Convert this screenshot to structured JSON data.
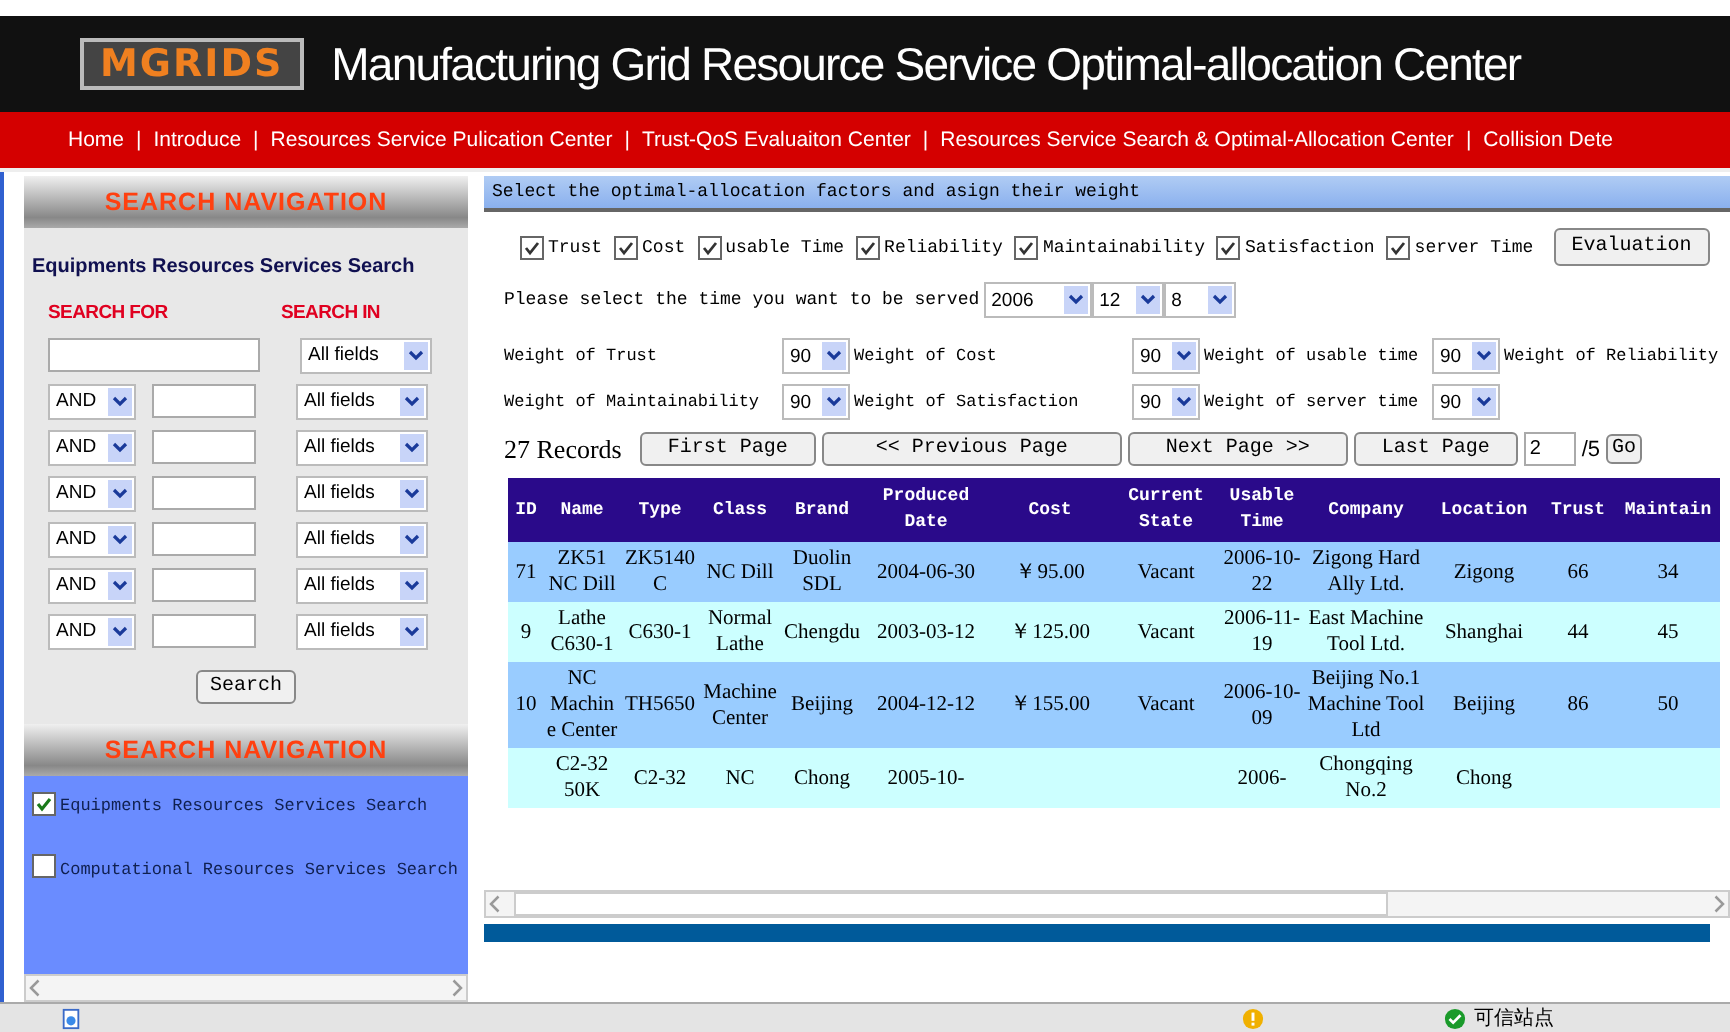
{
  "header": {
    "logo": "MGRIDS",
    "title": "Manufacturing  Grid Resource Service Optimal-allocation Center"
  },
  "nav": [
    {
      "label": "Home"
    },
    {
      "separator": "|",
      "label": "Introduce"
    },
    {
      "separator": "|",
      "label": "Resources Service Pulication Center"
    },
    {
      "separator": "|",
      "label": "Trust-QoS Evaluaiton Center"
    },
    {
      "separator": "|",
      "label": "Resources Service Search & Optimal-Allocation Center"
    },
    {
      "separator": "|",
      "label": "Collision Dete"
    }
  ],
  "left_panel": {
    "heading": "SEARCH NAVIGATION",
    "subtitle": "Equipments Resources Services Search",
    "search_for_label": "SEARCH FOR",
    "search_in_label": "SEARCH IN",
    "first_field": "All fields",
    "rows": [
      {
        "operator": "AND",
        "field": "All fields"
      },
      {
        "operator": "AND",
        "field": "All fields"
      },
      {
        "operator": "AND",
        "field": "All fields"
      },
      {
        "operator": "AND",
        "field": "All fields"
      },
      {
        "operator": "AND",
        "field": "All fields"
      },
      {
        "operator": "AND",
        "field": "All fields"
      }
    ],
    "search_button": "Search",
    "heading2": "SEARCH NAVIGATION",
    "options": [
      {
        "label": "Equipments Resources Services Search",
        "checked": true
      },
      {
        "label": "Computational Resources Services Search",
        "checked": false
      }
    ]
  },
  "main": {
    "section_title": "Select the optimal-allocation factors and asign their weight",
    "factors": [
      {
        "label": "Trust",
        "checked": true
      },
      {
        "label": "Cost",
        "checked": true
      },
      {
        "label": "usable Time",
        "checked": true
      },
      {
        "label": "Reliability",
        "checked": true
      },
      {
        "label": "Maintainability",
        "checked": true
      },
      {
        "label": "Satisfaction",
        "checked": true
      },
      {
        "label": "server Time",
        "checked": true
      }
    ],
    "evaluation_button": "Evaluation",
    "time_prompt": "Please select the time you want to be served",
    "time": [
      "2006",
      "12",
      "8"
    ],
    "weights": [
      {
        "label": "Weight of Trust",
        "value": "90"
      },
      {
        "label": "Weight of Cost",
        "value": "90"
      },
      {
        "label": "Weight of usable time",
        "value": "90"
      },
      {
        "label": "Weight of Reliability"
      },
      {
        "label": "Weight of Maintainability",
        "value": "90"
      },
      {
        "label": "Weight of Satisfaction",
        "value": "90"
      },
      {
        "label": "Weight of server time",
        "value": "90"
      }
    ],
    "records": "27 Records",
    "pager": [
      "First Page",
      "<< Previous Page",
      "Next Page >>",
      "Last Page"
    ],
    "page_input": "2",
    "page_total": "/5",
    "go_button": "Go",
    "table": {
      "columns": [
        "ID",
        "Name",
        "Type",
        "Class",
        "Brand",
        "Produced Date",
        "Cost",
        "Current State",
        "Usable Time",
        "Company",
        "Location",
        "Trust",
        "Maintain"
      ],
      "rows": [
        [
          "71",
          "ZK51 NC Dill",
          "ZK5140C",
          "NC Dill",
          "Duolin SDL",
          "2004-06-30",
          "￥95.00",
          "Vacant",
          "2006-10-22",
          "Zigong Hard Ally Ltd.",
          "Zigong",
          "66",
          "34"
        ],
        [
          "9",
          "Lathe C630-1",
          "C630-1",
          "Normal Lathe",
          "Chengdu",
          "2003-03-12",
          "￥125.00",
          "Vacant",
          "2006-11-19",
          "East Machine Tool Ltd.",
          "Shanghai",
          "44",
          "45"
        ],
        [
          "10",
          "NC Machine Center",
          "TH5650",
          "Machine Center",
          "Beijing",
          "2004-12-12",
          "￥155.00",
          "Vacant",
          "2006-10-09",
          "Beijing No.1 Machine Tool Ltd",
          "Beijing",
          "86",
          "50"
        ],
        [
          null,
          "C2-32 50K",
          "C2-32",
          "NC",
          "Chong",
          "2005-10-",
          null,
          null,
          "2006-",
          "Chongqing No.2",
          "Chong",
          null,
          null
        ]
      ]
    }
  },
  "status_bar": {
    "zone": "可信站点"
  }
}
